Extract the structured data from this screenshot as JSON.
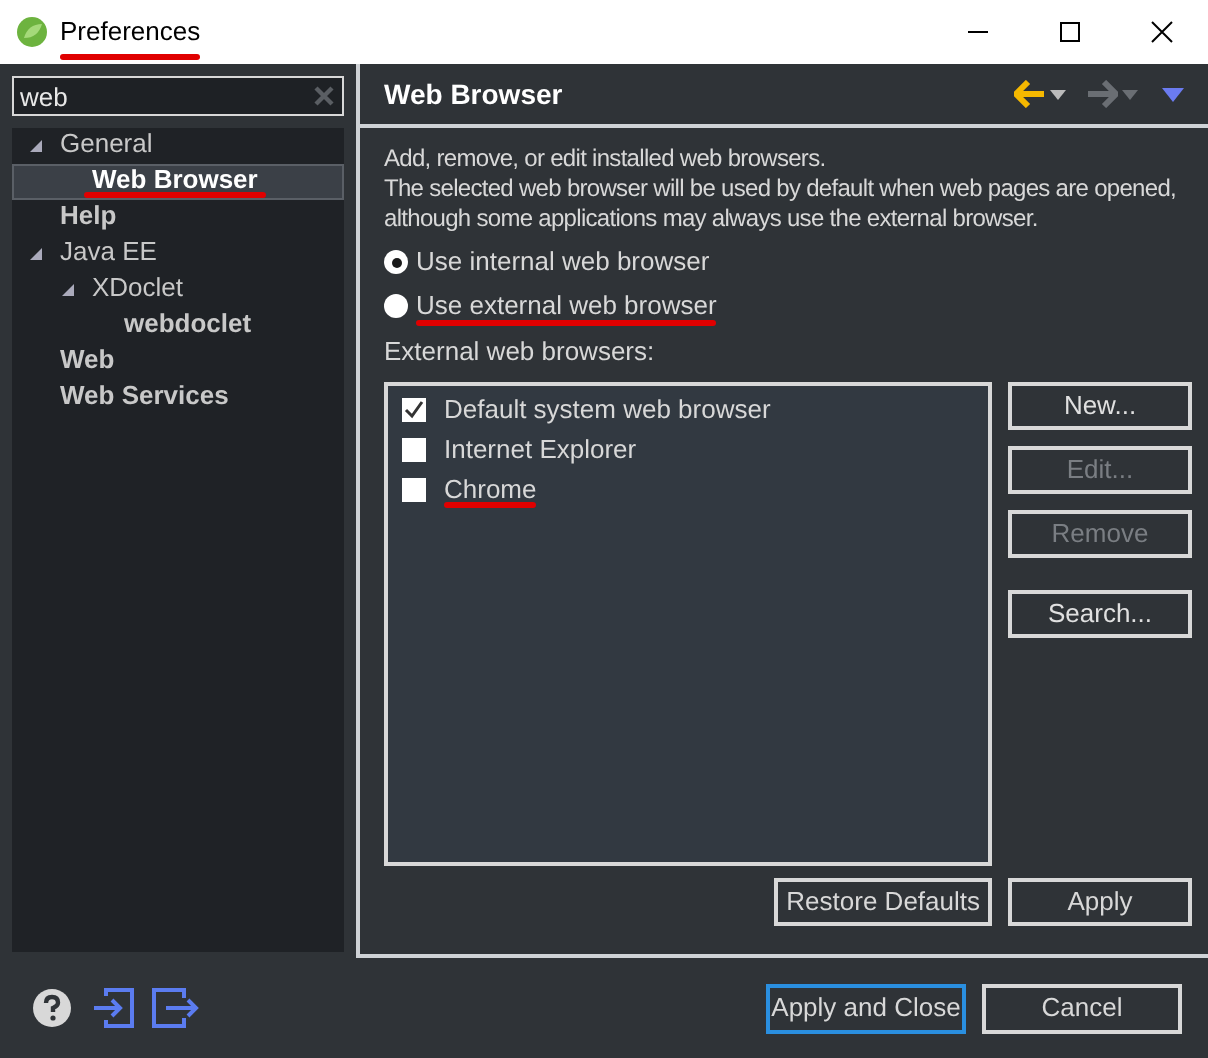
{
  "window": {
    "title": "Preferences",
    "underlined": true
  },
  "filter": {
    "value": "web"
  },
  "tree": [
    {
      "label": "General",
      "bold": false,
      "selected": false,
      "expanded": true,
      "underlined": false,
      "children": [
        {
          "label": "Web Browser",
          "bold": true,
          "selected": true,
          "underlined": true
        }
      ]
    },
    {
      "label": "Help",
      "bold": true,
      "selected": false,
      "underlined": false
    },
    {
      "label": "Java EE",
      "bold": false,
      "selected": false,
      "expanded": true,
      "underlined": false,
      "children": [
        {
          "label": "XDoclet",
          "bold": false,
          "selected": false,
          "expanded": true,
          "underlined": false,
          "children": [
            {
              "label": "webdoclet",
              "bold": true,
              "selected": false,
              "underlined": false
            }
          ]
        }
      ]
    },
    {
      "label": "Web",
      "bold": true,
      "selected": false,
      "underlined": false
    },
    {
      "label": "Web Services",
      "bold": true,
      "selected": false,
      "underlined": false
    }
  ],
  "page": {
    "title": "Web Browser",
    "description": [
      "Add, remove, or edit installed web browsers.",
      "The selected web browser will be used by default when web pages are opened, although some applications may always use the external browser."
    ],
    "radios": [
      {
        "label": "Use internal web browser",
        "selected": true,
        "underlined": false
      },
      {
        "label": "Use external web browser",
        "selected": false,
        "underlined": true
      }
    ],
    "list_label": "External web browsers:",
    "browsers": [
      {
        "label": "Default system web browser",
        "checked": true,
        "underlined": false
      },
      {
        "label": "Internet Explorer",
        "checked": false,
        "underlined": false
      },
      {
        "label": "Chrome",
        "checked": false,
        "underlined": true
      }
    ],
    "side_buttons": [
      {
        "label": "New...",
        "disabled": false
      },
      {
        "label": "Edit...",
        "disabled": true
      },
      {
        "label": "Remove",
        "disabled": true
      },
      {
        "label": "Search...",
        "disabled": false
      }
    ],
    "page_buttons": [
      "Restore Defaults",
      "Apply"
    ]
  },
  "footer_buttons": [
    {
      "label": "Apply and Close",
      "default": true
    },
    {
      "label": "Cancel",
      "default": false
    }
  ]
}
